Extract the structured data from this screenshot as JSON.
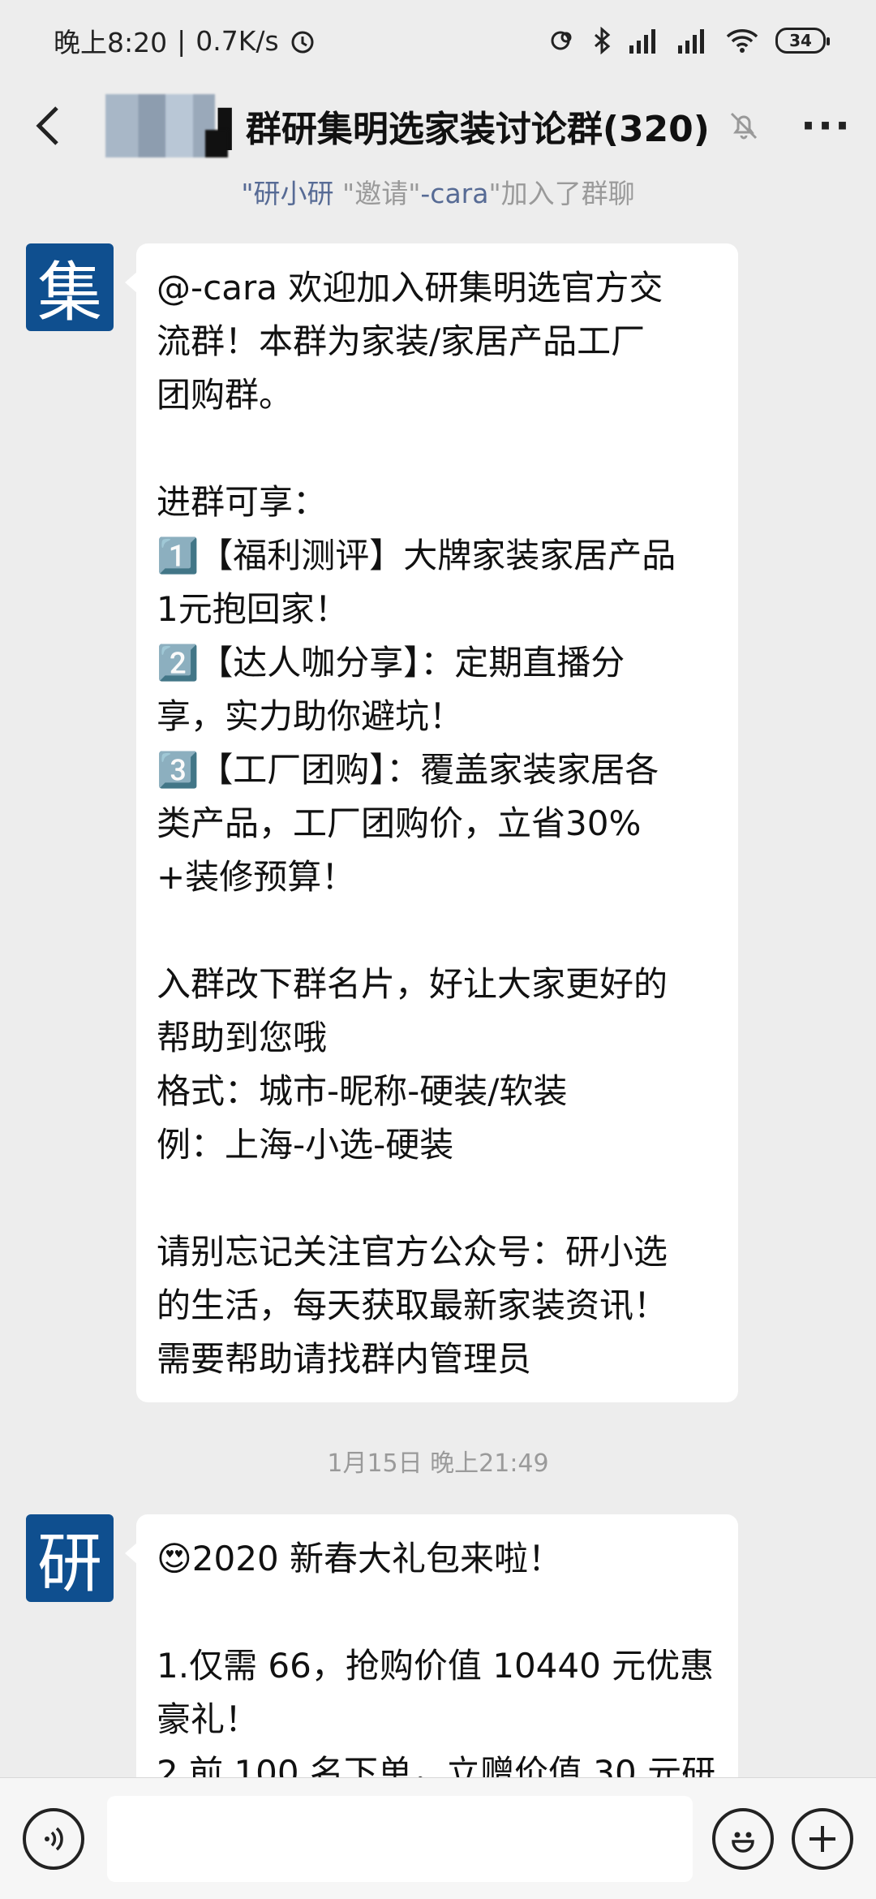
{
  "status_bar": {
    "time": "晚上8:20",
    "speed": "0.7K/s",
    "battery": "34"
  },
  "header": {
    "title": "▌群研集明选家装讨论群(320)",
    "more_label": "···"
  },
  "system_message": {
    "inviter": "\"研小研",
    "action": "\"邀请\"",
    "invitee": "-cara",
    "suffix": "\"加入了群聊"
  },
  "messages": [
    {
      "avatar_text": "集",
      "text": "@-cara 欢迎加入研集明选官方交\n流群！本群为家装/家居产品工厂\n团购群。\n\n进群可享：\n1️⃣【福利测评】大牌家装家居产品\n1元抱回家！\n2️⃣【达人咖分享】：定期直播分\n享，实力助你避坑！\n3️⃣【工厂团购】：覆盖家装家居各\n类产品，工厂团购价，立省30%\n+装修预算！\n\n入群改下群名片，好让大家更好的\n帮助到您哦\n格式：城市-昵称-硬装/软装\n例：上海-小选-硬装\n\n请别忘记关注官方公众号：研小选\n的生活，每天获取最新家装资讯！\n需要帮助请找群内管理员"
    },
    {
      "avatar_text": "研",
      "text": "😍2020 新春大礼包来啦！\n\n1.仅需 66，抢购价值 10440 元优惠\n豪礼！\n2.前 100 名下单，立赠价值 30 元研"
    }
  ],
  "timestamp": "1月15日 晚上21:49",
  "input_bar": {
    "placeholder": ""
  },
  "icons": [
    "back-arrow-icon",
    "mute-bell-icon",
    "more-icon",
    "voice-icon",
    "emoji-icon",
    "plus-icon",
    "alarm-icon",
    "bluetooth-icon",
    "signal-icon",
    "wifi-icon",
    "battery-icon"
  ]
}
